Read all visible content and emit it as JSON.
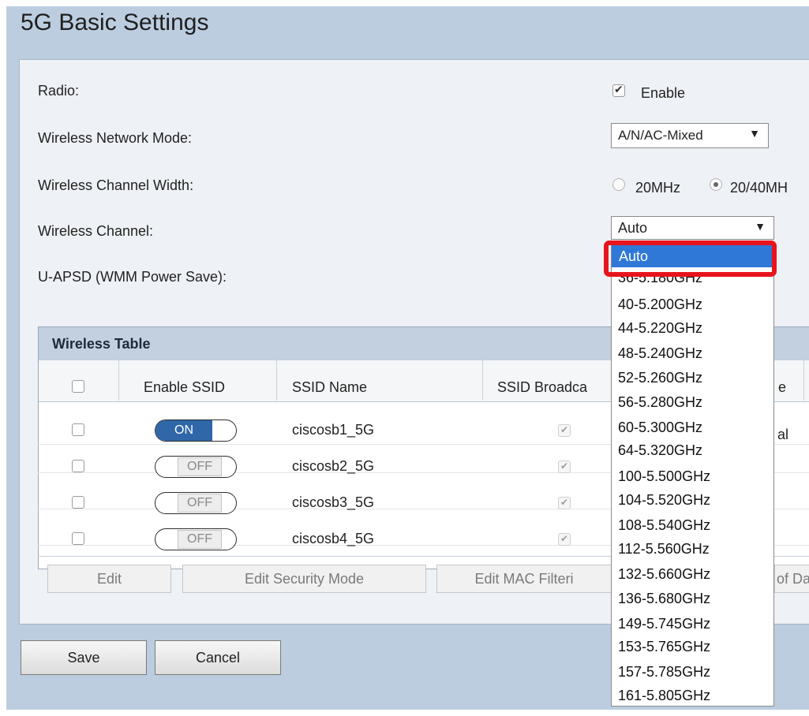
{
  "page": {
    "title": "5G Basic Settings"
  },
  "settings": {
    "radio_label": "Radio:",
    "radio_enable_label": "Enable",
    "mode_label": "Wireless Network Mode:",
    "mode_value": "A/N/AC-Mixed",
    "width_label": "Wireless Channel Width:",
    "width_options": [
      "20MHz",
      "20/40MH"
    ],
    "width_selected": "20/40MH",
    "channel_label": "Wireless Channel:",
    "channel_value": "Auto",
    "uapsd_label": "U-APSD (WMM Power Save):"
  },
  "wireless_table": {
    "title": "Wireless Table",
    "headers": [
      "Enable SSID",
      "SSID Name",
      "SSID Broadca",
      "e"
    ],
    "rows": [
      {
        "toggle": "ON",
        "ssid": "ciscosb1_5G",
        "broadcast": true,
        "extra": "al"
      },
      {
        "toggle": "OFF",
        "ssid": "ciscosb2_5G",
        "broadcast": true,
        "extra": ""
      },
      {
        "toggle": "OFF",
        "ssid": "ciscosb3_5G",
        "broadcast": true,
        "extra": ""
      },
      {
        "toggle": "OFF",
        "ssid": "ciscosb4_5G",
        "broadcast": true,
        "extra": ""
      }
    ],
    "actions": [
      "Edit",
      "Edit Security Mode",
      "Edit MAC Filteri",
      "of Da"
    ]
  },
  "footer": {
    "save": "Save",
    "cancel": "Cancel"
  },
  "channel_dropdown": {
    "options": [
      "Auto",
      "36-5.180GHz",
      "40-5.200GHz",
      "44-5.220GHz",
      "48-5.240GHz",
      "52-5.260GHz",
      "56-5.280GHz",
      "60-5.300GHz",
      "64-5.320GHz",
      "100-5.500GHz",
      "104-5.520GHz",
      "108-5.540GHz",
      "112-5.560GHz",
      "132-5.660GHz",
      "136-5.680GHz",
      "149-5.745GHz",
      "153-5.765GHz",
      "157-5.785GHz",
      "161-5.805GHz"
    ],
    "highlighted": "Auto"
  },
  "colors": {
    "page_bg": "#bccde0",
    "panel_bg": "#eef1f5",
    "toggle_on": "#2f67a8",
    "highlight": "#2f78d8",
    "annotation_red": "#e8141b"
  }
}
